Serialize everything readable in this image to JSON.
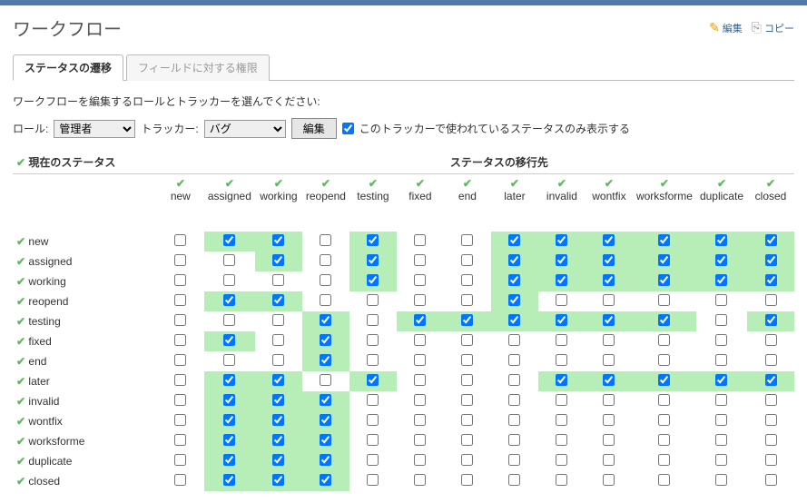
{
  "page_title": "ワークフロー",
  "actions": {
    "edit": "編集",
    "copy": "コピー"
  },
  "tabs": {
    "status": "ステータスの遷移",
    "fields": "フィールドに対する権限"
  },
  "instruction": "ワークフローを編集するロールとトラッカーを選んでください:",
  "filters": {
    "role_label": "ロール:",
    "role_value": "管理者",
    "tracker_label": "トラッカー:",
    "tracker_value": "バグ",
    "edit_button": "編集",
    "only_used": "このトラッカーで使われているステータスのみ表示する"
  },
  "table": {
    "current_status": "現在のステータス",
    "target_status": "ステータスの移行先",
    "statuses": [
      "new",
      "assigned",
      "working",
      "reopend",
      "testing",
      "fixed",
      "end",
      "later",
      "invalid",
      "wontfix",
      "worksforme",
      "duplicate",
      "closed"
    ],
    "matrix": [
      [
        0,
        1,
        1,
        0,
        1,
        0,
        0,
        1,
        1,
        1,
        1,
        1,
        1
      ],
      [
        0,
        0,
        1,
        0,
        1,
        0,
        0,
        1,
        1,
        1,
        1,
        1,
        1
      ],
      [
        0,
        0,
        0,
        0,
        1,
        0,
        0,
        1,
        1,
        1,
        1,
        1,
        1
      ],
      [
        0,
        1,
        1,
        0,
        0,
        0,
        0,
        1,
        0,
        0,
        0,
        0,
        0
      ],
      [
        0,
        0,
        0,
        1,
        0,
        1,
        1,
        1,
        1,
        1,
        1,
        0,
        1
      ],
      [
        0,
        1,
        0,
        1,
        0,
        0,
        0,
        0,
        0,
        0,
        0,
        0,
        0
      ],
      [
        0,
        0,
        0,
        1,
        0,
        0,
        0,
        0,
        0,
        0,
        0,
        0,
        0
      ],
      [
        0,
        1,
        1,
        0,
        1,
        0,
        0,
        0,
        1,
        1,
        1,
        1,
        1
      ],
      [
        0,
        1,
        1,
        1,
        0,
        0,
        0,
        0,
        0,
        0,
        0,
        0,
        0
      ],
      [
        0,
        1,
        1,
        1,
        0,
        0,
        0,
        0,
        0,
        0,
        0,
        0,
        0
      ],
      [
        0,
        1,
        1,
        1,
        0,
        0,
        0,
        0,
        0,
        0,
        0,
        0,
        0
      ],
      [
        0,
        1,
        1,
        1,
        0,
        0,
        0,
        0,
        0,
        0,
        0,
        0,
        0
      ],
      [
        0,
        1,
        1,
        1,
        0,
        0,
        0,
        0,
        0,
        0,
        0,
        0,
        0
      ]
    ]
  }
}
